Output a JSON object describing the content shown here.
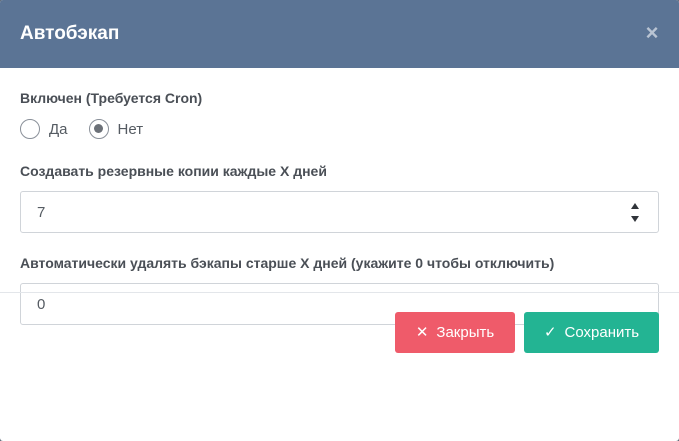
{
  "modal": {
    "title": "Автобэкап",
    "close_glyph": "×"
  },
  "form": {
    "enabled": {
      "label": "Включен (Требуется Cron)",
      "options": [
        {
          "label": "Да",
          "checked": false
        },
        {
          "label": "Нет",
          "checked": true
        }
      ]
    },
    "backup_days": {
      "label": "Создавать резервные копии каждые X дней",
      "value": "7"
    },
    "auto_delete_days": {
      "label": "Автоматически удалять бэкапы старше X дней (укажите 0 чтобы отключить)",
      "value": "0"
    }
  },
  "footer": {
    "close_label": "Закрыть",
    "close_icon": "close-icon",
    "save_label": "Сохранить",
    "save_icon": "check-icon",
    "close_color": "#ef5b6a",
    "save_color": "#23b493"
  },
  "colors": {
    "header_bg": "#5b7495"
  }
}
